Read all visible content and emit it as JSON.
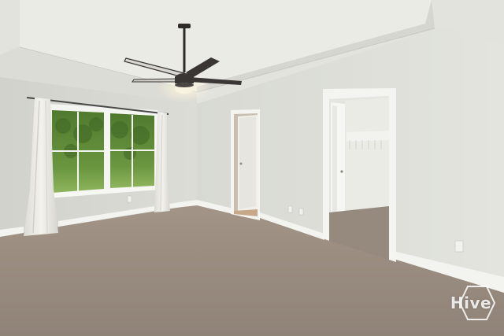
{
  "watermark": {
    "text": "Hive"
  },
  "colors": {
    "ceiling": "#e6e6e1",
    "wall_left": "#dcdcd6",
    "wall_back": "#dedfd9",
    "carpet": "#9a8d82",
    "trim": "#f4f4f0",
    "fan": "#3a3634",
    "foliage": "#5f8a3a",
    "curtain": "#ecebe6"
  }
}
